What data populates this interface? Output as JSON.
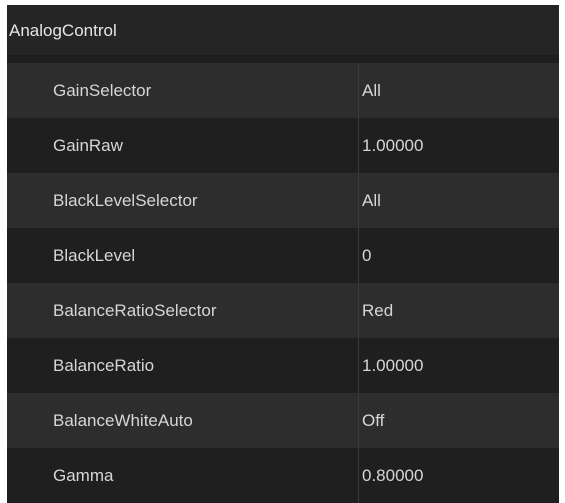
{
  "panel": {
    "title": "AnalogControl",
    "rows": [
      {
        "name": "GainSelector",
        "value": "All"
      },
      {
        "name": "GainRaw",
        "value": "1.00000"
      },
      {
        "name": "BlackLevelSelector",
        "value": "All"
      },
      {
        "name": "BlackLevel",
        "value": "0"
      },
      {
        "name": "BalanceRatioSelector",
        "value": "Red"
      },
      {
        "name": "BalanceRatio",
        "value": "1.00000"
      },
      {
        "name": "BalanceWhiteAuto",
        "value": "Off"
      },
      {
        "name": "Gamma",
        "value": "0.80000"
      }
    ]
  }
}
